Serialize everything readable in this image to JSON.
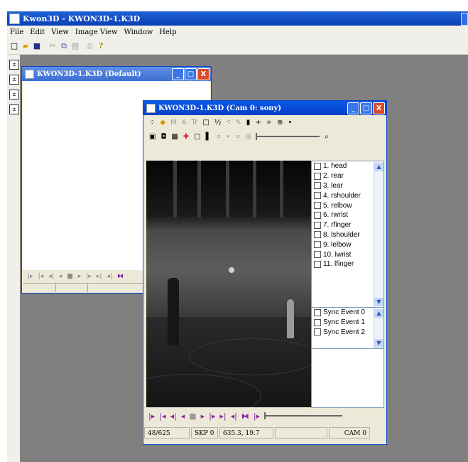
{
  "app": {
    "title": "Kwon3D - KWON3D-1.K3D"
  },
  "menu": [
    "File",
    "Edit",
    "View",
    "Image View",
    "Window",
    "Help"
  ],
  "toolbar_icons": [
    "new-icon",
    "open-icon",
    "save-icon",
    "cut-icon",
    "copy-icon",
    "paste-icon",
    "print-icon",
    "help-icon"
  ],
  "windows": {
    "default": {
      "title": "KWON3D-1.K3D (Default)"
    },
    "cam": {
      "title": "KWON3D-1.K3D (Cam 0: sony)",
      "points": [
        "1. head",
        "2. rear",
        "3. lear",
        "4. rshoulder",
        "5. relbow",
        "6. rwrist",
        "7. rfinger",
        "8. lshoulder",
        "9. lelbow",
        "10. lwrist",
        "11. lfinger"
      ],
      "events": [
        "Sync Event 0",
        "Sync Event 1",
        "Sync Event 2"
      ],
      "status": {
        "frame": "48/625",
        "skip": "SKP 0",
        "coords": "635.3, 19.7",
        "cam": "CAM 0"
      }
    }
  },
  "colors": {
    "titlebar": "#0a4fd8",
    "workspace": "#808080",
    "close": "#dc4a2a"
  }
}
